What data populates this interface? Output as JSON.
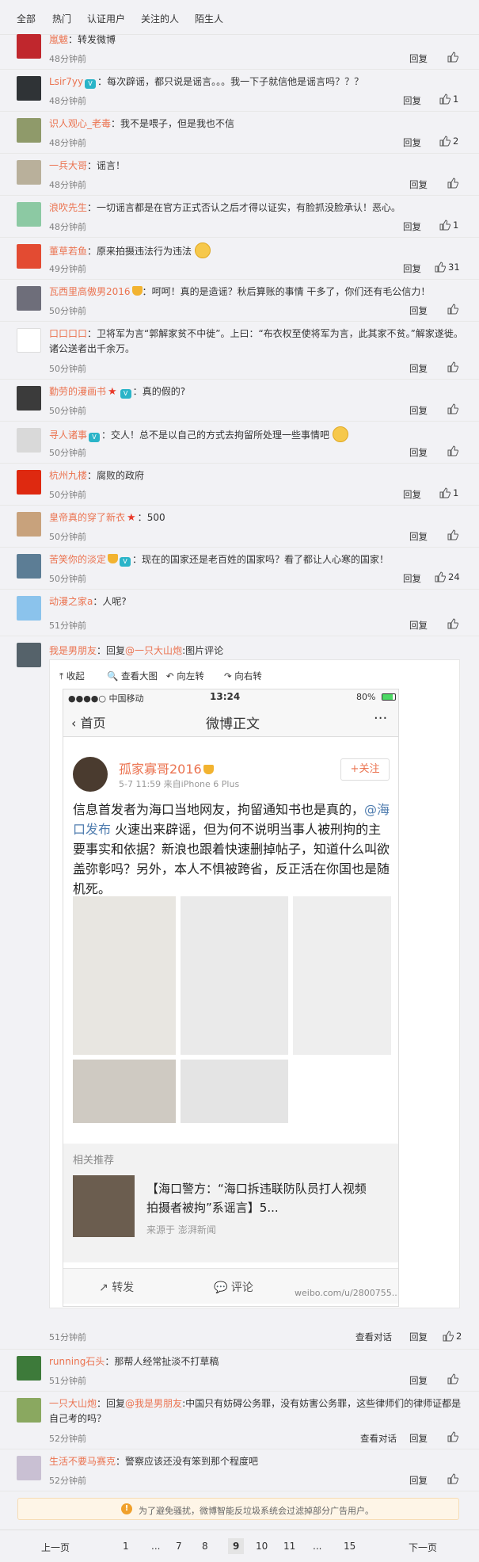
{
  "tabs": [
    "全部",
    "热门",
    "认证用户",
    "关注的人",
    "陌生人"
  ],
  "comments": [
    {
      "user": "嵐魃",
      "text": "转发微博",
      "time": "48分钟前",
      "reply": "回复",
      "likes": ""
    },
    {
      "user": "Lsir7yy",
      "text": "每次辟谣，都只说是谣言。。。我一下子就信他是谣言吗？？？",
      "time": "48分钟前",
      "reply": "回复",
      "likes": "1"
    },
    {
      "user": "识人观心_老毒",
      "text": "我不是喂子，但是我也不信",
      "time": "48分钟前",
      "reply": "回复",
      "likes": "2"
    },
    {
      "user": "一兵大哥",
      "text": "谣言！",
      "time": "48分钟前",
      "reply": "回复",
      "likes": ""
    },
    {
      "user": "浪吹先生",
      "text": "一切谣言都是在官方正式否认之后才得以证实，有脸抓没脸承认！恶心。",
      "time": "48分钟前",
      "reply": "回复",
      "likes": "1"
    },
    {
      "user": "董草若鱼",
      "text": "原来拍摄违法行为违法",
      "time": "49分钟前",
      "reply": "回复",
      "likes": "31"
    },
    {
      "user": "瓦西里高傲男2016",
      "text": "呵呵！真的是造谣？秋后算账的事情 干多了，你们还有毛公信力！",
      "time": "50分钟前",
      "reply": "回复",
      "likes": ""
    },
    {
      "user": "口口口口",
      "text": "卫将军为言“郭解家贫不中徙”。上曰：“布衣权至使将军为言，此其家不贫。”解家遂徙。诸公送者出千余万。",
      "time": "50分钟前",
      "reply": "回复",
      "likes": ""
    },
    {
      "user": "勤劳的漫画书",
      "text": "真的假的?",
      "time": "50分钟前",
      "reply": "回复",
      "likes": ""
    },
    {
      "user": "寻人诸事",
      "text": "交人！总不是以自己的方式去拘留所处理一些事情吧",
      "time": "50分钟前",
      "reply": "回复",
      "likes": ""
    },
    {
      "user": "杭州九楼",
      "text": "腐败的政府",
      "time": "50分钟前",
      "reply": "回复",
      "likes": "1"
    },
    {
      "user": "皇帝真的穿了新衣",
      "text": "500",
      "time": "50分钟前",
      "reply": "回复",
      "likes": ""
    },
    {
      "user": "苦笑你的淡定",
      "text": "现在的国家还是老百姓的国家吗？看了都让人心寒的国家！",
      "time": "50分钟前",
      "reply": "回复",
      "likes": "24"
    },
    {
      "user": "动漫之家a",
      "text": "人呢?",
      "time": "51分钟前",
      "reply": "回复",
      "likes": ""
    }
  ],
  "img_comment": {
    "user": "我是男朋友",
    "prefix": "回复",
    "mention": "@一只大山炮",
    "suffix": ":图片评论",
    "time": "51分钟前",
    "conversation": "查看对话",
    "reply": "回复",
    "likes": "2"
  },
  "img_toolbar": [
    "收起",
    "查看大图",
    "向左转",
    "向右转"
  ],
  "phone": {
    "carrier": "●●●●○ 中国移动",
    "clock": "13:24",
    "battery": "80%",
    "back": "首页",
    "title": "微博正文",
    "post_user": "孤家寡哥2016",
    "follow": "+关注",
    "post_meta": "5-7 11:59  来自iPhone 6 Plus",
    "post_text_1": "信息首发者为海口当地网友，拘留通知书也是真的，",
    "post_mention": "@海口发布",
    "post_text_2": " 火速出来辟谣，但为何不说明当事人被刑拘的主要事实和依据？新浪也跟着快速删掉帖子，知道什么叫欲盖弥彰吗？另外，本人不惧被跨省，反正活在你国也是随机死。",
    "related_title": "相关推荐",
    "related_headline": "【海口警方：“海口拆违联防队员打人视频拍摄者被拘”系谣言】5...",
    "related_source": "来源于 澎湃新闻",
    "action_repost": "转发",
    "action_comment": "评论",
    "watermark": "weibo.com/u/2800755..."
  },
  "after": [
    {
      "user": "running石头",
      "text": "那帮人经常扯淡不打草稿",
      "time": "51分钟前",
      "reply": "回复",
      "likes": ""
    },
    {
      "user": "一只大山炮",
      "prefix": "回复",
      "mention": "@我是男朋友",
      "text": ":中国只有妨碍公务罪，没有妨害公务罪，这些律师们的律师证都是自己考的吗？",
      "time": "52分钟前",
      "conversation": "查看对话",
      "reply": "回复",
      "likes": ""
    },
    {
      "user": "生活不要马赛克",
      "text": "警察应该还没有笨到那个程度吧",
      "time": "52分钟前",
      "reply": "回复",
      "likes": ""
    }
  ],
  "notice": "为了避免骚扰，微博智能反垃圾系统会过滤掉部分广告用户。",
  "pager": {
    "prev": "上一页",
    "pages": [
      "1",
      "...",
      "7",
      "8",
      "9",
      "10",
      "11",
      "...",
      "15"
    ],
    "current": "9",
    "next": "下一页"
  }
}
